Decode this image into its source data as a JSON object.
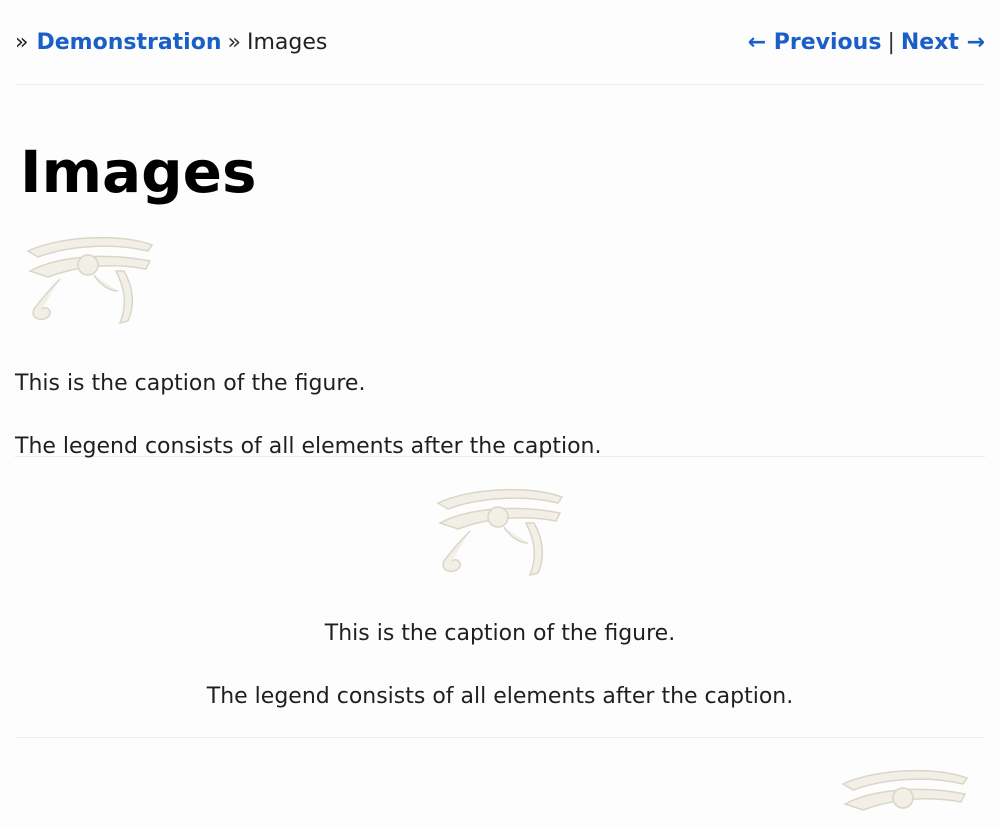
{
  "breadcrumb": {
    "prefix": "»",
    "parent_link": "Demonstration",
    "separator": "»",
    "current": "Images"
  },
  "pager": {
    "previous": "← Previous",
    "divider": "|",
    "next": "Next →"
  },
  "page_title": "Images",
  "figures": [
    {
      "caption": "This is the caption of the figure.",
      "legend": "The legend consists of all elements after the caption.",
      "image_icon": "eye-of-horus-icon"
    },
    {
      "caption": "This is the caption of the figure.",
      "legend": "The legend consists of all elements after the caption.",
      "image_icon": "eye-of-horus-icon"
    },
    {
      "image_icon": "eye-of-horus-icon"
    }
  ],
  "colors": {
    "link": "#1a5fc7",
    "divider": "#eaeaea",
    "image_fill": "#f0eee4"
  }
}
